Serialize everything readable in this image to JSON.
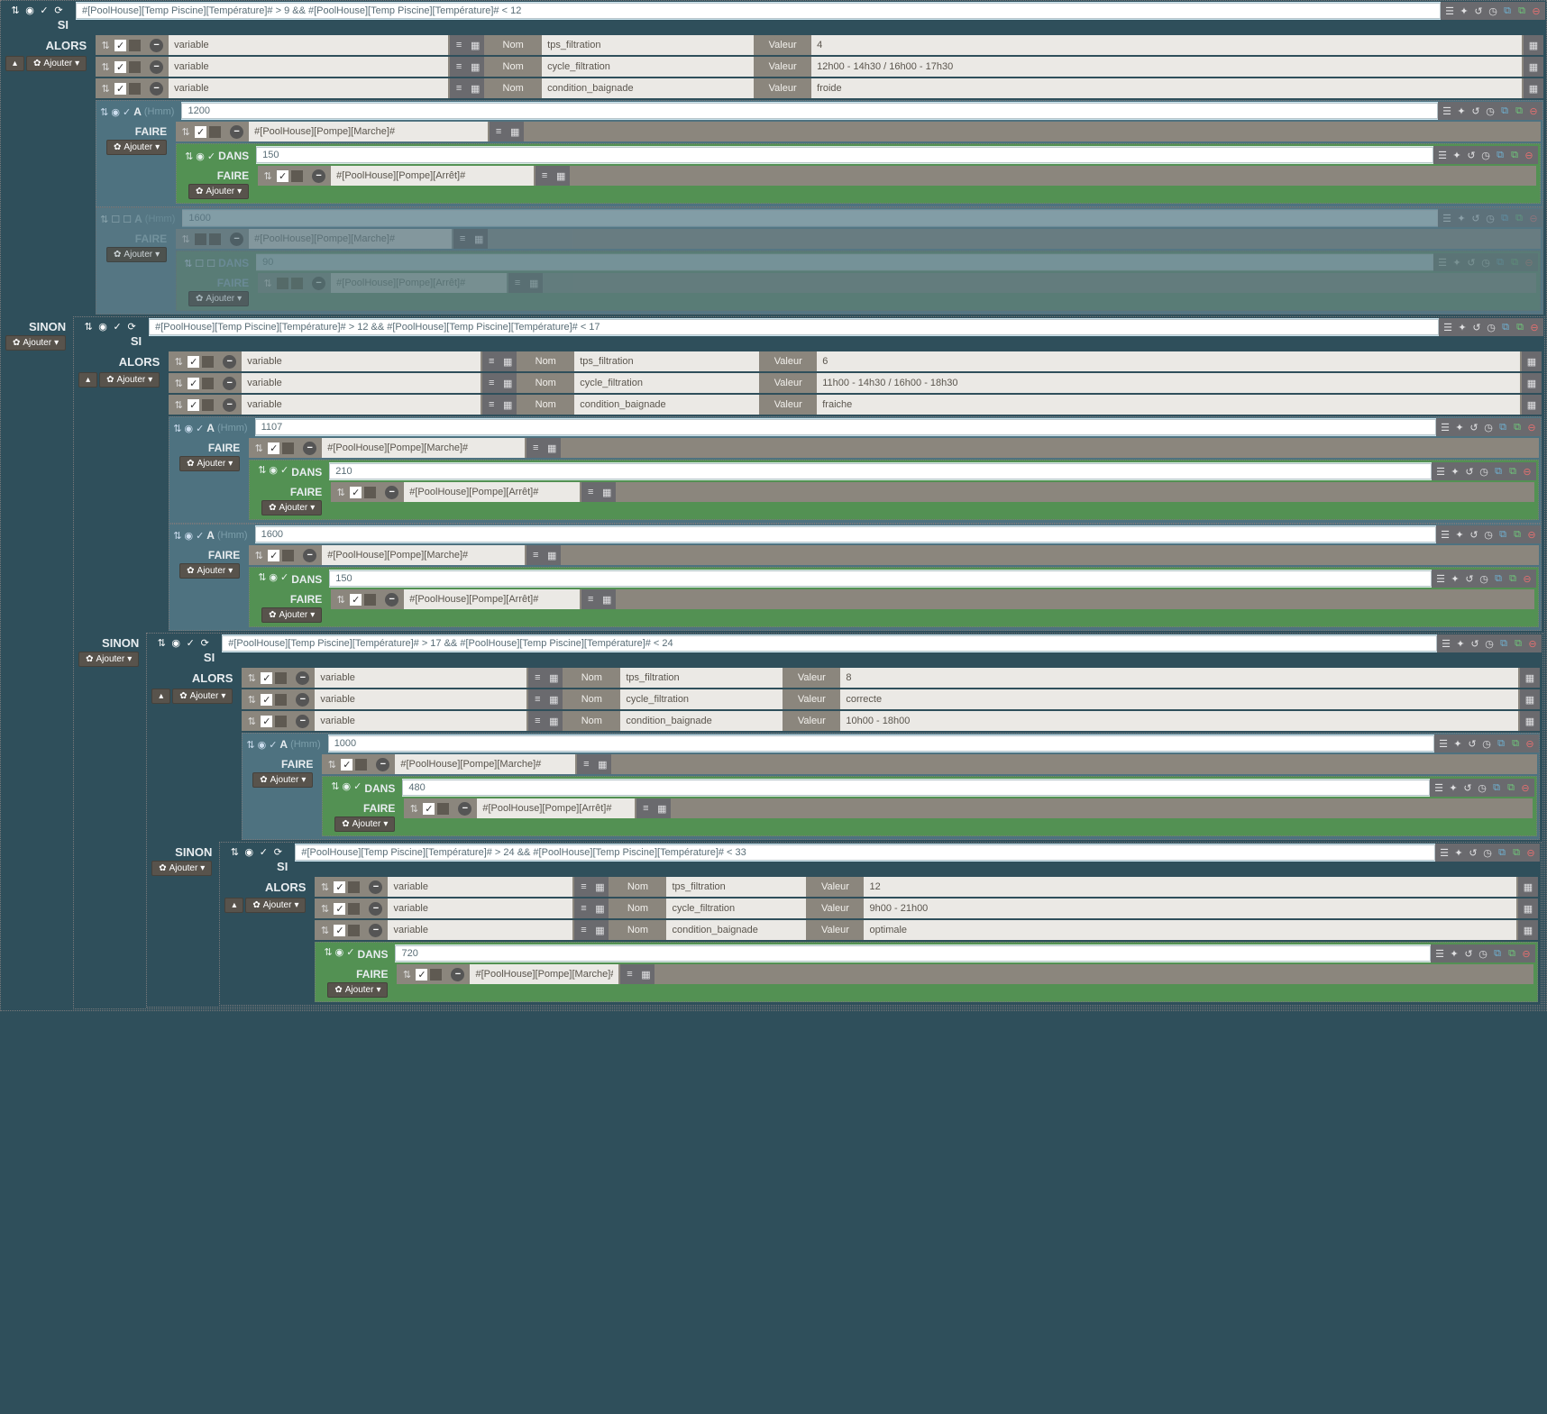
{
  "kw": {
    "si": "SI",
    "alors": "ALORS",
    "sinon": "SINON",
    "faire": "FAIRE",
    "dans": "DANS",
    "a": "A",
    "hmm": "(Hmm)",
    "ajouter": "Ajouter",
    "nom": "Nom",
    "valeur": "Valeur",
    "variable": "variable"
  },
  "si1": {
    "cond": "#[PoolHouse][Temp Piscine][Température]# > 9 && #[PoolHouse][Temp Piscine][Température]# < 12",
    "alors": {
      "vars": [
        {
          "nom": "tps_filtration",
          "val": "4"
        },
        {
          "nom": "cycle_filtration",
          "val": "12h00 - 14h30 / 16h00 - 17h30"
        },
        {
          "nom": "condition_baignade",
          "val": "froide"
        }
      ],
      "a1": {
        "time": "1200",
        "faire": {
          "act": "#[PoolHouse][Pompe][Marche]#"
        },
        "dans": {
          "delay": "150",
          "faire": {
            "act": "#[PoolHouse][Pompe][Arrêt]#"
          }
        }
      },
      "a2": {
        "disabled": true,
        "time": "1600",
        "faire": {
          "act": "#[PoolHouse][Pompe][Marche]#"
        },
        "dans": {
          "delay": "90",
          "faire": {
            "act": "#[PoolHouse][Pompe][Arrêt]#"
          }
        }
      }
    },
    "sinon": {
      "si2": {
        "cond": "#[PoolHouse][Temp Piscine][Température]# > 12 && #[PoolHouse][Temp Piscine][Température]# < 17",
        "alors": {
          "vars": [
            {
              "nom": "tps_filtration",
              "val": "6"
            },
            {
              "nom": "cycle_filtration",
              "val": "11h00 - 14h30 / 16h00 - 18h30"
            },
            {
              "nom": "condition_baignade",
              "val": "fraiche"
            }
          ],
          "a1": {
            "time": "1107",
            "faire": {
              "act": "#[PoolHouse][Pompe][Marche]#"
            },
            "dans": {
              "delay": "210",
              "faire": {
                "act": "#[PoolHouse][Pompe][Arrêt]#"
              }
            }
          },
          "a2": {
            "time": "1600",
            "faire": {
              "act": "#[PoolHouse][Pompe][Marche]#"
            },
            "dans": {
              "delay": "150",
              "faire": {
                "act": "#[PoolHouse][Pompe][Arrêt]#"
              }
            }
          }
        },
        "sinon": {
          "si3": {
            "cond": "#[PoolHouse][Temp Piscine][Température]# > 17 && #[PoolHouse][Temp Piscine][Température]# < 24",
            "alors": {
              "vars": [
                {
                  "nom": "tps_filtration",
                  "val": "8"
                },
                {
                  "nom": "cycle_filtration",
                  "val": "correcte"
                },
                {
                  "nom": "condition_baignade",
                  "val": "10h00 - 18h00"
                }
              ],
              "a1": {
                "time": "1000",
                "faire": {
                  "act": "#[PoolHouse][Pompe][Marche]#"
                },
                "dans": {
                  "delay": "480",
                  "faire": {
                    "act": "#[PoolHouse][Pompe][Arrêt]#"
                  }
                }
              }
            },
            "sinon": {
              "si4": {
                "cond": "#[PoolHouse][Temp Piscine][Température]# > 24 && #[PoolHouse][Temp Piscine][Température]# < 33",
                "alors": {
                  "vars": [
                    {
                      "nom": "tps_filtration",
                      "val": "12"
                    },
                    {
                      "nom": "cycle_filtration",
                      "val": "9h00 - 21h00"
                    },
                    {
                      "nom": "condition_baignade",
                      "val": "optimale"
                    }
                  ],
                  "dans": {
                    "delay": "720",
                    "faire": {
                      "act": "#[PoolHouse][Pompe][Marche]#"
                    }
                  }
                }
              }
            }
          }
        }
      }
    }
  }
}
